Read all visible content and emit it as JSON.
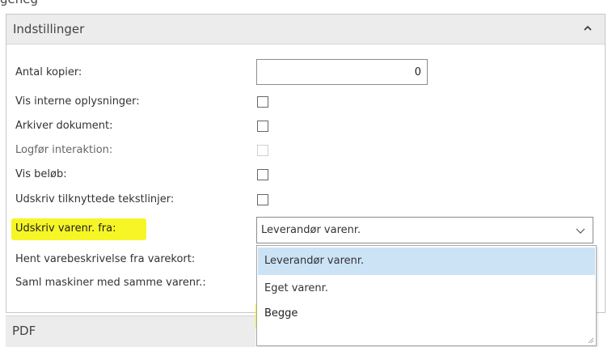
{
  "top_clipped_text": "geneg",
  "settings_section": {
    "title": "Indstillinger",
    "fields": {
      "copies": {
        "label": "Antal kopier:",
        "value": "0"
      },
      "internal_info": {
        "label": "Vis interne oplysninger:"
      },
      "archive_doc": {
        "label": "Arkiver dokument:"
      },
      "log_interaction": {
        "label": "Logfør interaktion:"
      },
      "show_amount": {
        "label": "Vis beløb:"
      },
      "attached_text": {
        "label": "Udskriv tilknyttede tekstlinjer:"
      },
      "print_item_no_from": {
        "label": "Udskriv varenr. fra:",
        "value": "Leverandør varenr."
      },
      "get_description": {
        "label": "Hent varebeskrivelse fra varekort:"
      },
      "collect_machines": {
        "label": "Saml maskiner med samme varenr.:"
      }
    }
  },
  "dropdown": {
    "options": [
      "Leverandør varenr.",
      "Eget varenr.",
      "Begge"
    ],
    "selected_index": 0
  },
  "pdf_section": {
    "title": "PDF"
  },
  "colors": {
    "highlight": "#f6f627",
    "selected_option": "#cce3f6",
    "header_bg": "#ececec"
  }
}
